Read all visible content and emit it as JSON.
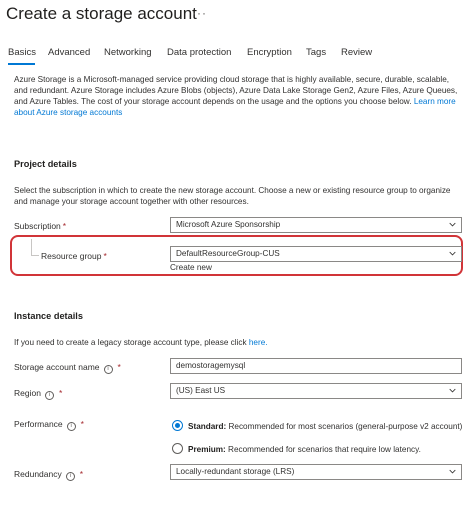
{
  "header": {
    "title": "Create a storage account",
    "more_menu": "···"
  },
  "tabs": [
    {
      "label": "Basics",
      "selected": true
    },
    {
      "label": "Advanced"
    },
    {
      "label": "Networking"
    },
    {
      "label": "Data protection"
    },
    {
      "label": "Encryption"
    },
    {
      "label": "Tags"
    },
    {
      "label": "Review"
    }
  ],
  "intro": {
    "text": "Azure Storage is a Microsoft-managed service providing cloud storage that is highly available, secure, durable, scalable, and redundant. Azure Storage includes Azure Blobs (objects), Azure Data Lake Storage Gen2, Azure Files, Azure Queues, and Azure Tables. The cost of your storage account depends on the usage and the options you choose below.",
    "link": "Learn more about Azure storage accounts"
  },
  "project": {
    "heading": "Project details",
    "description": "Select the subscription in which to create the new storage account. Choose a new or existing resource group to organize and manage your storage account together with other resources.",
    "subscription_label": "Subscription",
    "subscription_value": "Microsoft Azure Sponsorship",
    "resource_group_label": "Resource group",
    "resource_group_value": "DefaultResourceGroup-CUS",
    "create_new": "Create new"
  },
  "instance": {
    "heading": "Instance details",
    "legacy_text": "If you need to create a legacy storage account type, please click",
    "legacy_link": "here.",
    "name_label": "Storage account name",
    "name_value": "demostoragemysql",
    "region_label": "Region",
    "region_value": "(US) East US",
    "performance_label": "Performance",
    "standard_bold": "Standard:",
    "standard_desc": "Recommended for most scenarios (general-purpose v2 account)",
    "premium_bold": "Premium:",
    "premium_desc": "Recommended for scenarios that require low latency.",
    "redundancy_label": "Redundancy",
    "redundancy_value": "Locally-redundant storage (LRS)"
  },
  "required_marker": "*",
  "info_glyph": "i",
  "colors": {
    "accent": "#0078d4",
    "highlight_border": "#d13438",
    "required": "#a4262c"
  }
}
